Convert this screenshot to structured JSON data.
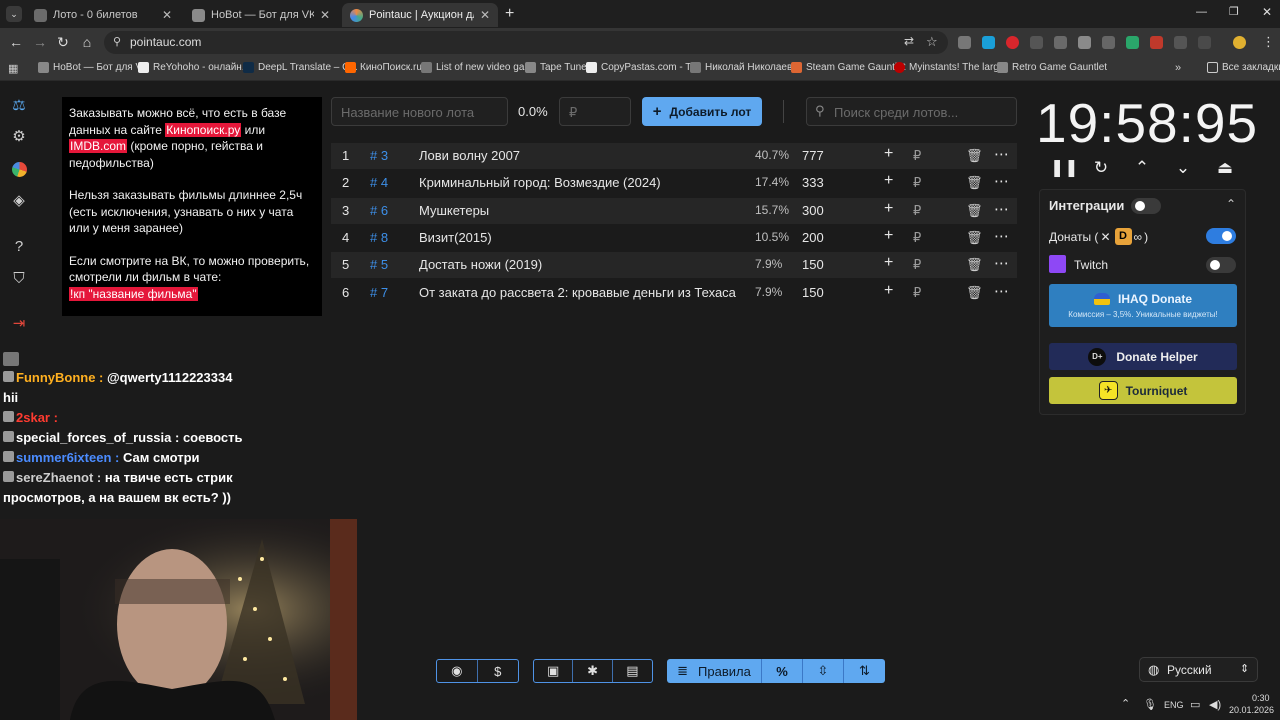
{
  "browser": {
    "tabs": [
      {
        "title": "Лото - 0 билетов",
        "active": false
      },
      {
        "title": "HoBot — Бот для VK Video Live",
        "active": false
      },
      {
        "title": "Pointauc | Аукцион для стримеров",
        "active": true
      }
    ],
    "url": "pointauc.com",
    "bookmarks": [
      "HoBot — Бот для V...",
      "ReYohoho - онлайн...",
      "DeepL Translate – С...",
      "КиноПоиск.ru",
      "List of new video ga...",
      "Tape Tune",
      "CopyPastas.com - T...",
      "Николай Николаев...",
      "Steam Game Gauntlet",
      "Myinstants! The larg...",
      "Retro Game Gauntlet"
    ],
    "all_bookmarks": "Все закладки"
  },
  "info": {
    "p1_a": "Заказывать можно всё, что есть в базе данных на сайте ",
    "p1_link1": "Кинопоиск.ру",
    "p1_mid": " или ",
    "p1_link2": "IMDB.com",
    "p1_b": " (кроме порно, гейства и педофильства)",
    "p2": "Нельзя заказывать фильмы длиннее 2,5ч (есть исключения, узнавать о них у чата или у меня заранее)",
    "p3": "Если смотрите на ВК, то можно проверить, смотрели ли фильм в чате:",
    "p3_cmd": "!кп \"название фильма\""
  },
  "topbar": {
    "new_lot_placeholder": "Название нового лота",
    "percent": "0.0%",
    "amount_placeholder": "₽",
    "add_button": "Добавить лот",
    "search_placeholder": "Поиск среди лотов..."
  },
  "lots": [
    {
      "num": "1",
      "id": "# 3",
      "name": "Лови волну 2007",
      "pct": "40.7%",
      "amount": "777"
    },
    {
      "num": "2",
      "id": "# 4",
      "name": "Криминальный город: Возмездие (2024)",
      "pct": "17.4%",
      "amount": "333"
    },
    {
      "num": "3",
      "id": "# 6",
      "name": "Мушкетеры",
      "pct": "15.7%",
      "amount": "300"
    },
    {
      "num": "4",
      "id": "# 8",
      "name": "Визит(2015)",
      "pct": "10.5%",
      "amount": "200"
    },
    {
      "num": "5",
      "id": "# 5",
      "name": "Достать ножи (2019)",
      "pct": "7.9%",
      "amount": "150"
    },
    {
      "num": "6",
      "id": "# 7",
      "name": "От заката до рассвета 2: кровавые деньги из Техаса",
      "pct": "7.9%",
      "amount": "150"
    }
  ],
  "currency_symbol": "₽",
  "timer": "19:58:95",
  "integrations": {
    "title": "Интеграции",
    "donations_label": "Донаты (",
    "donations_paren_close": ")",
    "twitch_label": "Twitch",
    "ihaq_title": "IHAQ Donate",
    "ihaq_sub": "Комиссия – 3,5%. Уникальные виджеты!",
    "donate_helper": "Donate Helper",
    "tourniquet": "Tourniquet"
  },
  "chat": [
    {
      "user": "FunnyBonne",
      "user_color": "#ffb020",
      "msg": "@qwerty1112223334"
    },
    {
      "user": "",
      "user_color": "#ffffff",
      "msg": "hii"
    },
    {
      "user": "2skar",
      "user_color": "#ff3b30",
      "msg": ""
    },
    {
      "user": "special_forces_of_russia",
      "user_color": "#ffffff",
      "msg": "соевость"
    },
    {
      "user": "summer6ixteen",
      "user_color": "#4b8cff",
      "msg": "Сам смотри"
    },
    {
      "user": "sereZhaenot",
      "user_color": "#cfcfcf",
      "msg": "на твиче есть стрик"
    },
    {
      "user": "",
      "user_color": "#ffffff",
      "msg": "просмотров, а на вашем вк есть? ))"
    }
  ],
  "toolbar": {
    "rules_label": "Правила",
    "percent_icon": "%"
  },
  "language": "Русский",
  "tray": {
    "lang": "ENG",
    "time": "0:30",
    "date": "20.01.2026"
  }
}
